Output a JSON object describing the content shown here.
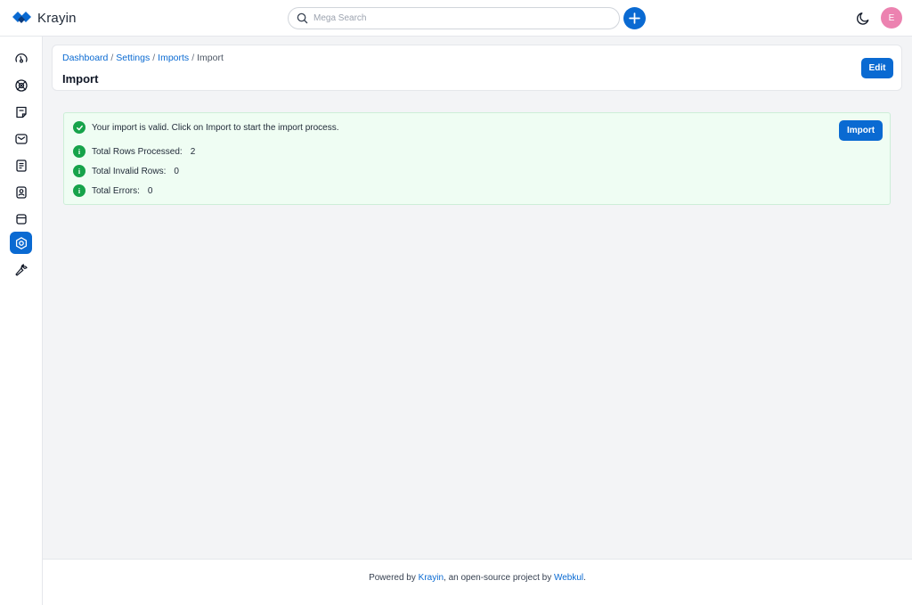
{
  "app": {
    "name": "Krayin",
    "brand_colors": {
      "primary": "#0a6ad2",
      "success": "#16a34a",
      "avatar": "#ec82b0"
    }
  },
  "header": {
    "search_placeholder": "Mega Search",
    "user_initial": "E",
    "icons": [
      "search-icon",
      "plus-icon",
      "moon-icon"
    ]
  },
  "sidebar": {
    "items": [
      {
        "name": "dashboard",
        "icon": "gauge-icon",
        "active": false
      },
      {
        "name": "leads",
        "icon": "leads-icon",
        "active": false
      },
      {
        "name": "quotes",
        "icon": "quote-icon",
        "active": false
      },
      {
        "name": "mail",
        "icon": "mail-icon",
        "active": false
      },
      {
        "name": "activities",
        "icon": "activity-icon",
        "active": false
      },
      {
        "name": "contacts",
        "icon": "contact-icon",
        "active": false
      },
      {
        "name": "products",
        "icon": "box-icon",
        "active": false
      },
      {
        "name": "settings",
        "icon": "settings-icon",
        "active": true
      },
      {
        "name": "configuration",
        "icon": "wrench-icon",
        "active": false
      }
    ]
  },
  "page": {
    "breadcrumb": [
      "Dashboard",
      "Settings",
      "Imports",
      "Import"
    ],
    "title": "Import",
    "edit_label": "Edit"
  },
  "validation": {
    "message": "Your import is valid. Click on Import to start the import process.",
    "import_label": "Import",
    "stats": [
      {
        "label": "Total Rows Processed:",
        "value": "2"
      },
      {
        "label": "Total Invalid Rows:",
        "value": "0"
      },
      {
        "label": "Total Errors:",
        "value": "0"
      }
    ]
  },
  "footer": {
    "prefix": "Powered by ",
    "krayin_link": "Krayin",
    "middle": ", an open-source project by ",
    "webkul_link": "Webkul",
    "suffix": "."
  }
}
